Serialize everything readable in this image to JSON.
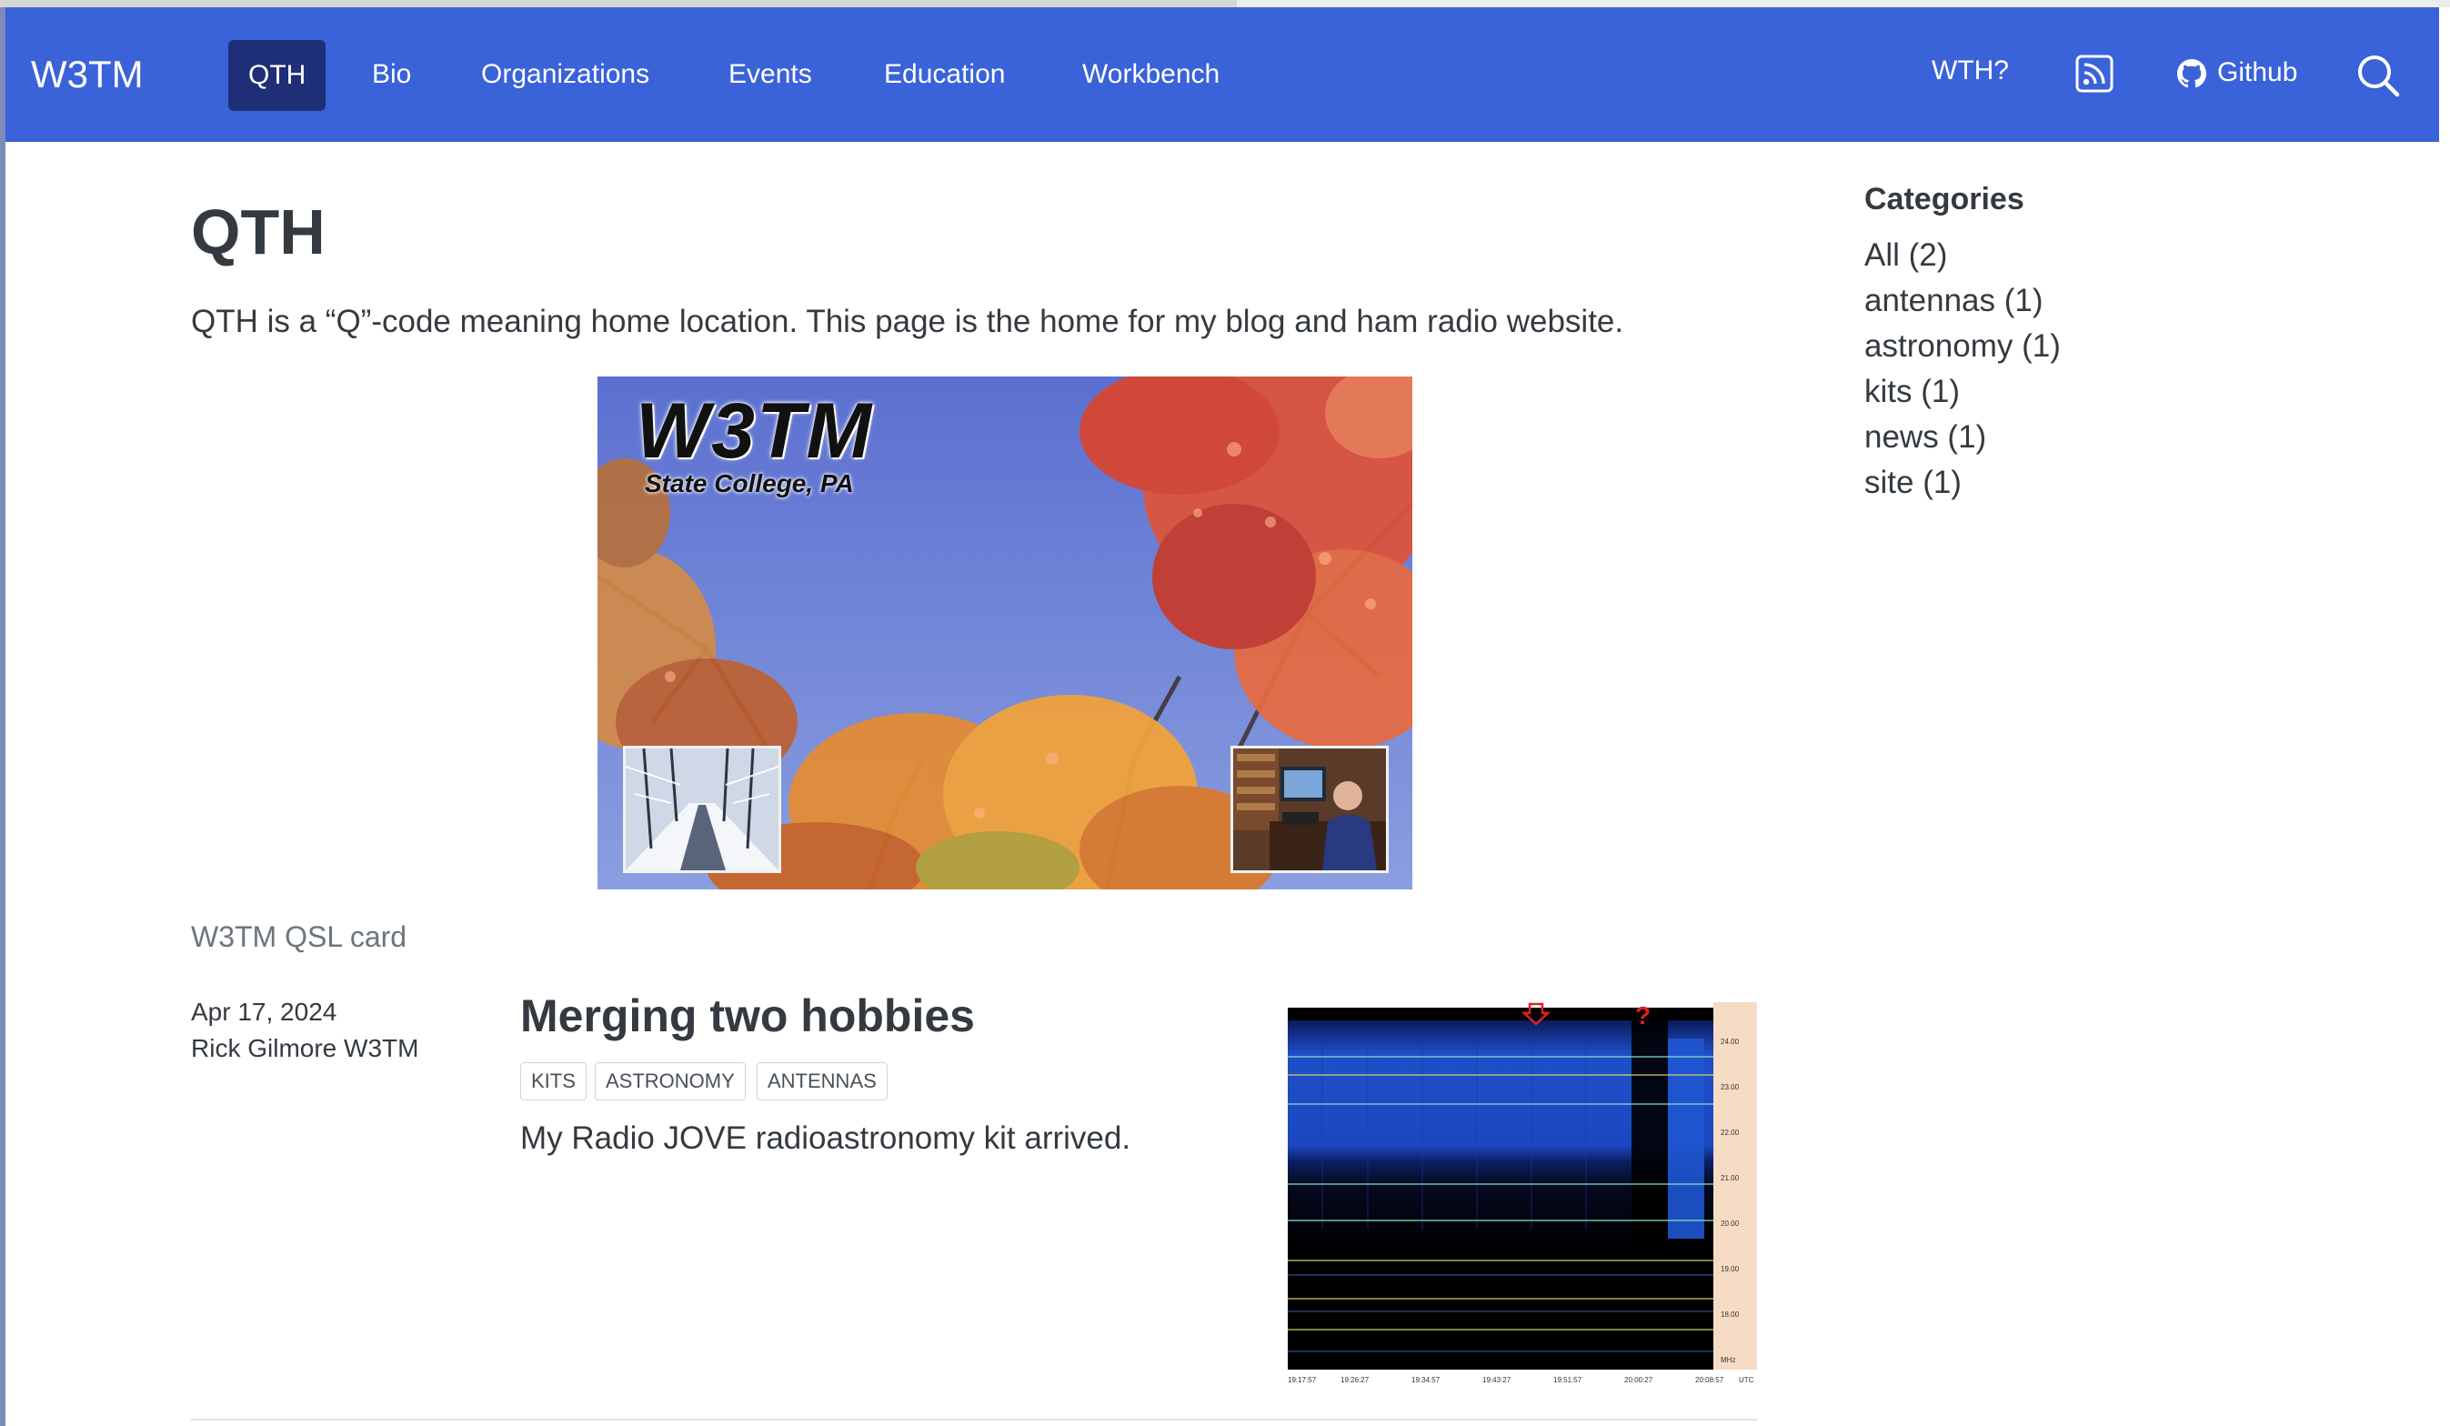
{
  "navbar": {
    "brand": "W3TM",
    "items": [
      {
        "label": "QTH",
        "active": true
      },
      {
        "label": "Bio"
      },
      {
        "label": "Organizations"
      },
      {
        "label": "Events"
      },
      {
        "label": "Education"
      },
      {
        "label": "Workbench"
      }
    ],
    "right": {
      "wth_label": "WTH?",
      "rss_icon": "rss-icon",
      "github_label": "Github",
      "github_icon": "github-icon",
      "search_icon": "search-icon"
    },
    "colors": {
      "background": "#3a62d9",
      "active_item": "#1e2f78",
      "text": "#ffffff"
    }
  },
  "main": {
    "title": "QTH",
    "intro": "QTH is a “Q”-code meaning home location. This page is the home for my blog and ham radio website.",
    "qsl_card": {
      "callsign": "W3TM",
      "location": "State College, PA",
      "caption": "W3TM QSL card"
    },
    "posts": [
      {
        "date": "Apr 17, 2024",
        "author": "Rick Gilmore W3TM",
        "title": "Merging two hobbies",
        "tags": [
          "KITS",
          "ASTRONOMY",
          "ANTENNAS"
        ],
        "description": "My Radio JOVE radioastronomy kit arrived.",
        "thumbnail": {
          "y_ticks": [
            "24.00",
            "23.00",
            "22.00",
            "21.00",
            "20.00",
            "19.00",
            "18.00",
            "MHz"
          ],
          "x_ticks": [
            "19:17:57",
            "19:26:27",
            "19:34:57",
            "19:43:27",
            "19:51:57",
            "20:00:27",
            "20:08:57",
            "UTC"
          ],
          "marker": "?"
        }
      }
    ]
  },
  "sidebar": {
    "heading": "Categories",
    "categories": [
      {
        "label": "All (2)"
      },
      {
        "label": "antennas (1)"
      },
      {
        "label": "astronomy (1)"
      },
      {
        "label": "kits (1)"
      },
      {
        "label": "news (1)"
      },
      {
        "label": "site (1)"
      }
    ]
  }
}
